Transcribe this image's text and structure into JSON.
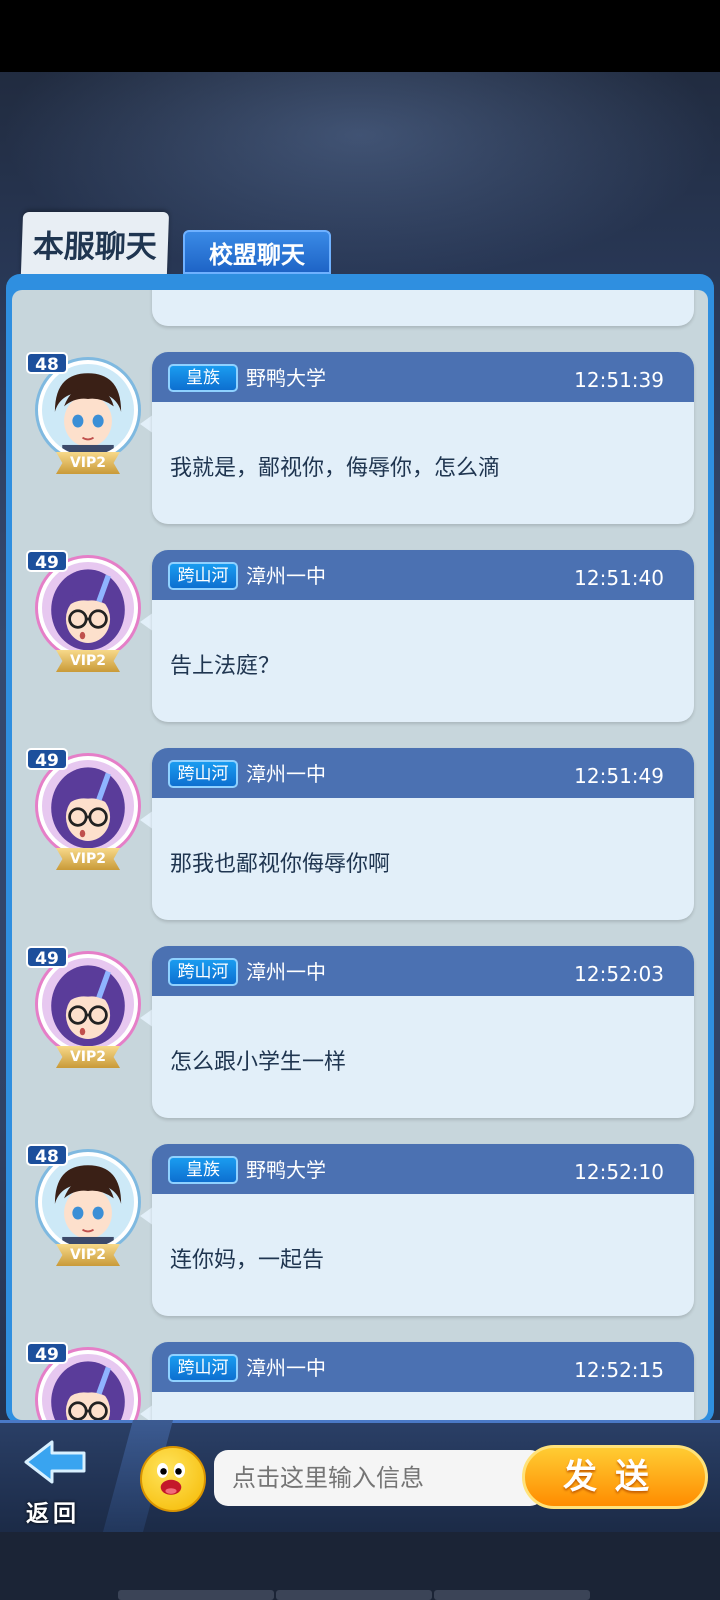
{
  "tabs": {
    "active": "本服聊天",
    "inactive": "校盟聊天"
  },
  "messages": [
    {
      "level": "48",
      "vip": "VIP2",
      "avatar": "boy",
      "title": "皇族",
      "school": "野鸭大学",
      "time": "12:51:39",
      "text": "我就是，鄙视你，侮辱你，怎么滴"
    },
    {
      "level": "49",
      "vip": "VIP2",
      "avatar": "girl",
      "title": "跨山河",
      "school": "漳州一中",
      "time": "12:51:40",
      "text": "告上法庭？"
    },
    {
      "level": "49",
      "vip": "VIP2",
      "avatar": "girl",
      "title": "跨山河",
      "school": "漳州一中",
      "time": "12:51:49",
      "text": "那我也鄙视你侮辱你啊"
    },
    {
      "level": "49",
      "vip": "VIP2",
      "avatar": "girl",
      "title": "跨山河",
      "school": "漳州一中",
      "time": "12:52:03",
      "text": "怎么跟小学生一样"
    },
    {
      "level": "48",
      "vip": "VIP2",
      "avatar": "boy",
      "title": "皇族",
      "school": "野鸭大学",
      "time": "12:52:10",
      "text": "连你妈，一起告"
    },
    {
      "level": "49",
      "vip": "VIP2",
      "avatar": "girl",
      "title": "跨山河",
      "school": "漳州一中",
      "time": "12:52:15",
      "text": ""
    }
  ],
  "bottom": {
    "back_label": "返回",
    "input_placeholder": "点击这里输入信息",
    "send_label": "发送"
  }
}
